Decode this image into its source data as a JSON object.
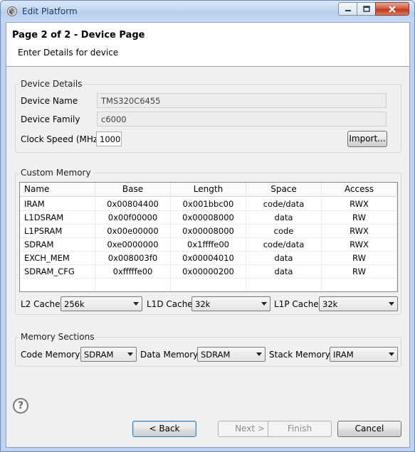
{
  "window": {
    "title": "Edit Platform"
  },
  "header": {
    "title": "Page 2 of 2 - Device Page",
    "subtitle": "Enter Details for device"
  },
  "device_details": {
    "label": "Device Details",
    "device_name_label": "Device Name",
    "device_name": "TMS320C6455",
    "device_family_label": "Device Family",
    "device_family": "c6000",
    "clock_speed_label": "Clock Speed (MHz)",
    "clock_speed": "1000",
    "import_label": "Import..."
  },
  "custom_memory": {
    "label": "Custom Memory",
    "columns": [
      "Name",
      "Base",
      "Length",
      "Space",
      "Access"
    ],
    "rows": [
      [
        "IRAM",
        "0x00804400",
        "0x001bbc00",
        "code/data",
        "RWX"
      ],
      [
        "L1DSRAM",
        "0x00f00000",
        "0x00008000",
        "data",
        "RW"
      ],
      [
        "L1PSRAM",
        "0x00e00000",
        "0x00008000",
        "code",
        "RWX"
      ],
      [
        "SDRAM",
        "0xe0000000",
        "0x1ffffe00",
        "code/data",
        "RWX"
      ],
      [
        "EXCH_MEM",
        "0x008003f0",
        "0x00004010",
        "data",
        "RW"
      ],
      [
        "SDRAM_CFG",
        "0xfffffe00",
        "0x00000200",
        "data",
        "RW"
      ]
    ],
    "l2_label": "L2 Cache:",
    "l2_value": "256k",
    "l1d_label": "L1D Cache:",
    "l1d_value": "32k",
    "l1p_label": "L1P Cache:",
    "l1p_value": "32k"
  },
  "memory_sections": {
    "label": "Memory Sections",
    "code_label": "Code Memory:",
    "code_value": "SDRAM",
    "data_label": "Data Memory:",
    "data_value": "SDRAM",
    "stack_label": "Stack Memory:",
    "stack_value": "IRAM"
  },
  "footer": {
    "help_glyph": "?",
    "back_label": "< Back",
    "next_label": "Next >",
    "finish_label": "Finish",
    "cancel_label": "Cancel"
  }
}
